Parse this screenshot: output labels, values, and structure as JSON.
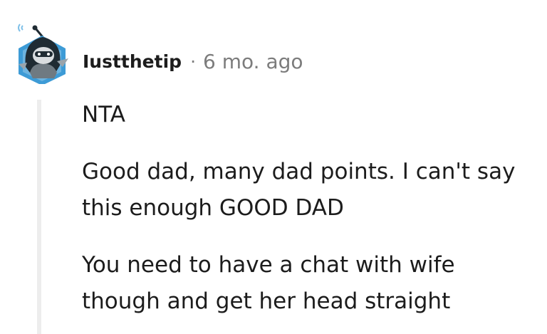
{
  "comment": {
    "author": "Iustthetip",
    "separator": "·",
    "timestamp": "6 mo. ago",
    "avatar_icon": "hooded-snoo-avatar-icon",
    "paragraphs": [
      [
        "NTA"
      ],
      [
        "Good dad, many dad points. I can't say",
        "this enough GOOD DAD"
      ],
      [
        "You need to have a chat with wife",
        "though and get her head straight"
      ]
    ]
  },
  "colors": {
    "text": "#1c1c1c",
    "meta": "#7c7c7c",
    "thread_line": "#ededed",
    "avatar_hex": "#3d9bd6",
    "avatar_hood": "#1f2b33"
  }
}
